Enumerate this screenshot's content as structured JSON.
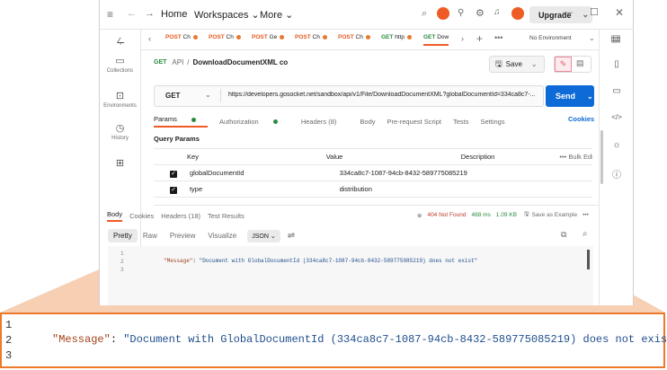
{
  "topbar": {
    "home": "Home",
    "workspaces": "Workspaces",
    "more": "More",
    "upgrade": "Upgrade"
  },
  "sidebar": {
    "items": [
      {
        "label": ""
      },
      {
        "label": "Collections"
      },
      {
        "label": "Environments"
      },
      {
        "label": "History"
      },
      {
        "label": ""
      }
    ]
  },
  "tabs": [
    {
      "method": "POST",
      "name": "Ch"
    },
    {
      "method": "POST",
      "name": "Ch"
    },
    {
      "method": "POST",
      "name": "Ge"
    },
    {
      "method": "POST",
      "name": "Ch"
    },
    {
      "method": "POST",
      "name": "Ch"
    },
    {
      "method": "GET",
      "name": "http"
    },
    {
      "method": "GET",
      "name": "Dow"
    }
  ],
  "environment": "No Environment",
  "breadcrumb": {
    "collection": "API",
    "separator": "/",
    "request": "DownloadDocumentXML co"
  },
  "actions": {
    "save": "Save"
  },
  "request": {
    "method": "GET",
    "url": "https://developers.gosocket.net/sandbox/api/v1/File/DownloadDocumentXML?globalDocumentId=334ca8c7-...",
    "send": "Send"
  },
  "param_tabs": [
    "Params",
    "Authorization",
    "Headers (8)",
    "Body",
    "Pre-request Script",
    "Tests",
    "Settings"
  ],
  "cookies_link": "Cookies",
  "query_params": {
    "title": "Query Params",
    "headers": {
      "key": "Key",
      "value": "Value",
      "description": "Description",
      "bulk": "Bulk Edit"
    },
    "rows": [
      {
        "key": "globalDocumentId",
        "value": "334ca8c7-1087-94cb-8432-589775085219"
      },
      {
        "key": "type",
        "value": "distribution"
      }
    ]
  },
  "response": {
    "tabs": [
      "Body",
      "Cookies",
      "Headers (18)",
      "Test Results"
    ],
    "status": "404 Not Found",
    "time": "488 ms",
    "size": "1.09 KB",
    "save_example": "Save as Example",
    "view_tabs": [
      "Pretty",
      "Raw",
      "Preview",
      "Visualize"
    ],
    "format": "JSON",
    "lines": [
      {
        "num": "1",
        "key": "",
        "value": ""
      },
      {
        "num": "2",
        "key": "\"Message\"",
        "value": "\"Document with GlobalDocumentId (334ca8c7-1087-94cb-8432-589775085219) does not exist\""
      },
      {
        "num": "3",
        "key": "",
        "value": ""
      }
    ]
  },
  "colors": {
    "accent": "#0d6ad6",
    "post": "#e55a1f",
    "get": "#2b8a3e",
    "zoom_border": "#ec7a2a",
    "json_key": "#a3421b",
    "json_string": "#1f4e8c"
  }
}
